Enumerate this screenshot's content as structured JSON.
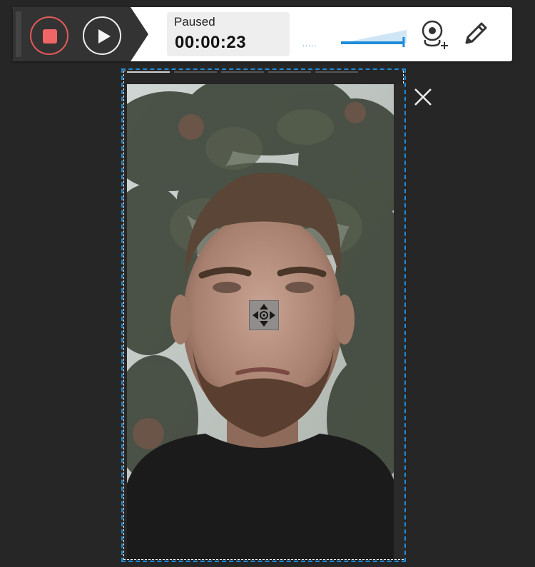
{
  "toolbar": {
    "status_label": "Paused",
    "timer": "00:00:23",
    "volume_level_percent": 95,
    "buttons": {
      "stop": "stop-icon",
      "play": "play-icon",
      "webcam": "webcam-add-icon",
      "annotate": "pencil-icon"
    }
  },
  "colors": {
    "accent": "#1e8bd9",
    "stop": "#f06565",
    "panel_dark": "#333333",
    "background": "#262626"
  }
}
